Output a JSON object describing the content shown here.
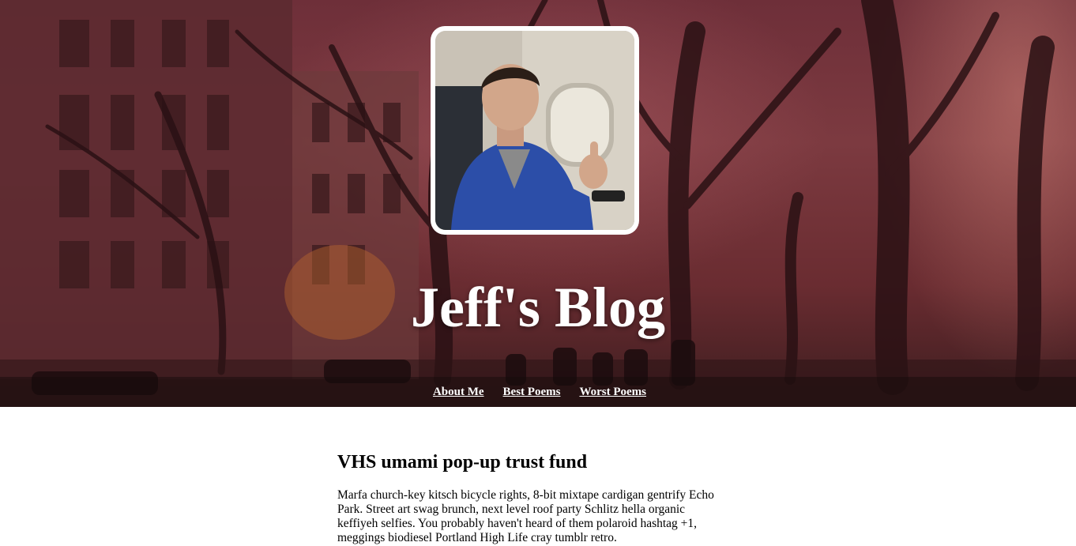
{
  "header": {
    "title": "Jeff's Blog",
    "background_tint": "#7c3a40"
  },
  "nav": {
    "items": [
      {
        "label": "About Me"
      },
      {
        "label": "Best Poems"
      },
      {
        "label": "Worst Poems"
      }
    ]
  },
  "post": {
    "title": "VHS umami pop-up trust fund",
    "body": "Marfa church-key kitsch bicycle rights, 8-bit mixtape cardigan gentrify Echo Park. Street art swag brunch, next level roof party Schlitz hella organic keffiyeh selfies. You probably haven't heard of them polaroid hashtag +1, meggings biodiesel Portland High Life cray tumblr retro."
  }
}
